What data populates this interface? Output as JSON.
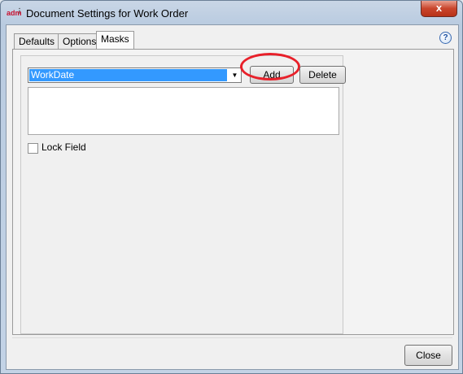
{
  "window": {
    "title": "Document Settings for Work Order",
    "app_icon_text": "adm",
    "close_glyph": "x"
  },
  "help": {
    "glyph": "?"
  },
  "tabs": [
    {
      "label": "Defaults",
      "active": false
    },
    {
      "label": "Options",
      "active": false
    },
    {
      "label": "Masks",
      "active": true
    }
  ],
  "masks": {
    "field_select": {
      "value": "WorkDate",
      "arrow_glyph": "▼"
    },
    "add_label": "Add",
    "delete_label": "Delete",
    "lock_field": {
      "label": "Lock Field",
      "checked": false
    }
  },
  "footer": {
    "close_label": "Close"
  },
  "colors": {
    "selection": "#3399ff",
    "highlight_ring": "#e8202a",
    "titlebar": "#b9cbe0"
  }
}
